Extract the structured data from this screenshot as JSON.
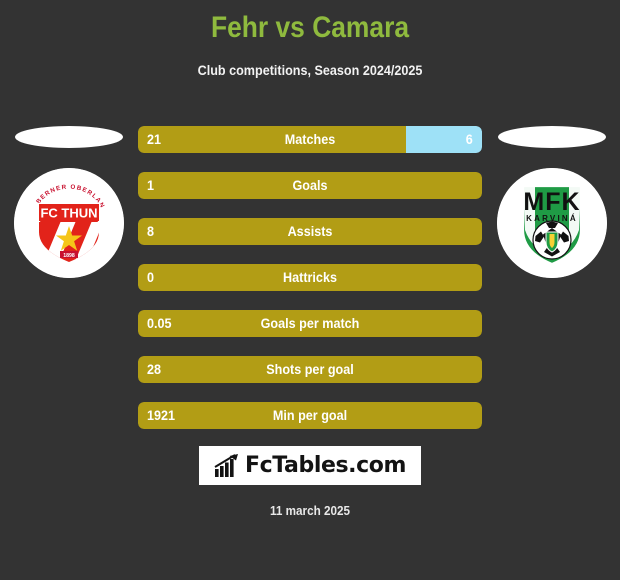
{
  "header": {
    "title": "Fehr vs Camara",
    "subtitle": "Club competitions, Season 2024/2025",
    "title_color": "#8fba3e",
    "subtitle_color": "#f2f2f2"
  },
  "theme": {
    "background": "#333333",
    "home_bar_color": "#b29d15",
    "away_bar_color": "#9ee1f7",
    "text_color": "#ffffff"
  },
  "teams": {
    "home": {
      "name": "FC Thun",
      "crest_text_top": "BERNER OBERLAND",
      "crest_text_main": "FC THUN",
      "crest_text_year": "1898",
      "primary_color": "#e2231a",
      "accent_color": "#f5c518"
    },
    "away": {
      "name": "MFK Karvina",
      "crest_text_main": "MFK",
      "crest_text_sub": "KARVINÁ",
      "primary_color": "#1f9b45",
      "accent_color": "#ffffff"
    }
  },
  "chart_data": {
    "type": "bar",
    "title": "Fehr vs Camara",
    "subtitle": "Club competitions, Season 2024/2025",
    "orientation": "horizontal-stacked",
    "categories": [
      "Matches",
      "Goals",
      "Assists",
      "Hattricks",
      "Goals per match",
      "Shots per goal",
      "Min per goal"
    ],
    "series": [
      {
        "name": "Fehr",
        "color": "#b29d15",
        "values": [
          21,
          1,
          8,
          0,
          0.05,
          28,
          1921
        ],
        "display": [
          "21",
          "1",
          "8",
          "0",
          "0.05",
          "28",
          "1921"
        ]
      },
      {
        "name": "Camara",
        "color": "#9ee1f7",
        "values": [
          6,
          null,
          null,
          null,
          null,
          null,
          null
        ],
        "display": [
          "6",
          "",
          "",
          "",
          "",
          "",
          ""
        ]
      }
    ],
    "legend_position": "none",
    "grid": false
  },
  "rows": [
    {
      "label": "Matches",
      "home_value": "21",
      "away_value": "6",
      "home_pct": 77.8,
      "away_pct": 22.2
    },
    {
      "label": "Goals",
      "home_value": "1",
      "away_value": "",
      "home_pct": 100,
      "away_pct": 0
    },
    {
      "label": "Assists",
      "home_value": "8",
      "away_value": "",
      "home_pct": 100,
      "away_pct": 0
    },
    {
      "label": "Hattricks",
      "home_value": "0",
      "away_value": "",
      "home_pct": 100,
      "away_pct": 0
    },
    {
      "label": "Goals per match",
      "home_value": "0.05",
      "away_value": "",
      "home_pct": 100,
      "away_pct": 0
    },
    {
      "label": "Shots per goal",
      "home_value": "28",
      "away_value": "",
      "home_pct": 100,
      "away_pct": 0
    },
    {
      "label": "Min per goal",
      "home_value": "1921",
      "away_value": "",
      "home_pct": 100,
      "away_pct": 0
    }
  ],
  "footer": {
    "brand": "FcTables.com",
    "brand_icon": "bar-chart-icon",
    "date": "11 march 2025"
  }
}
